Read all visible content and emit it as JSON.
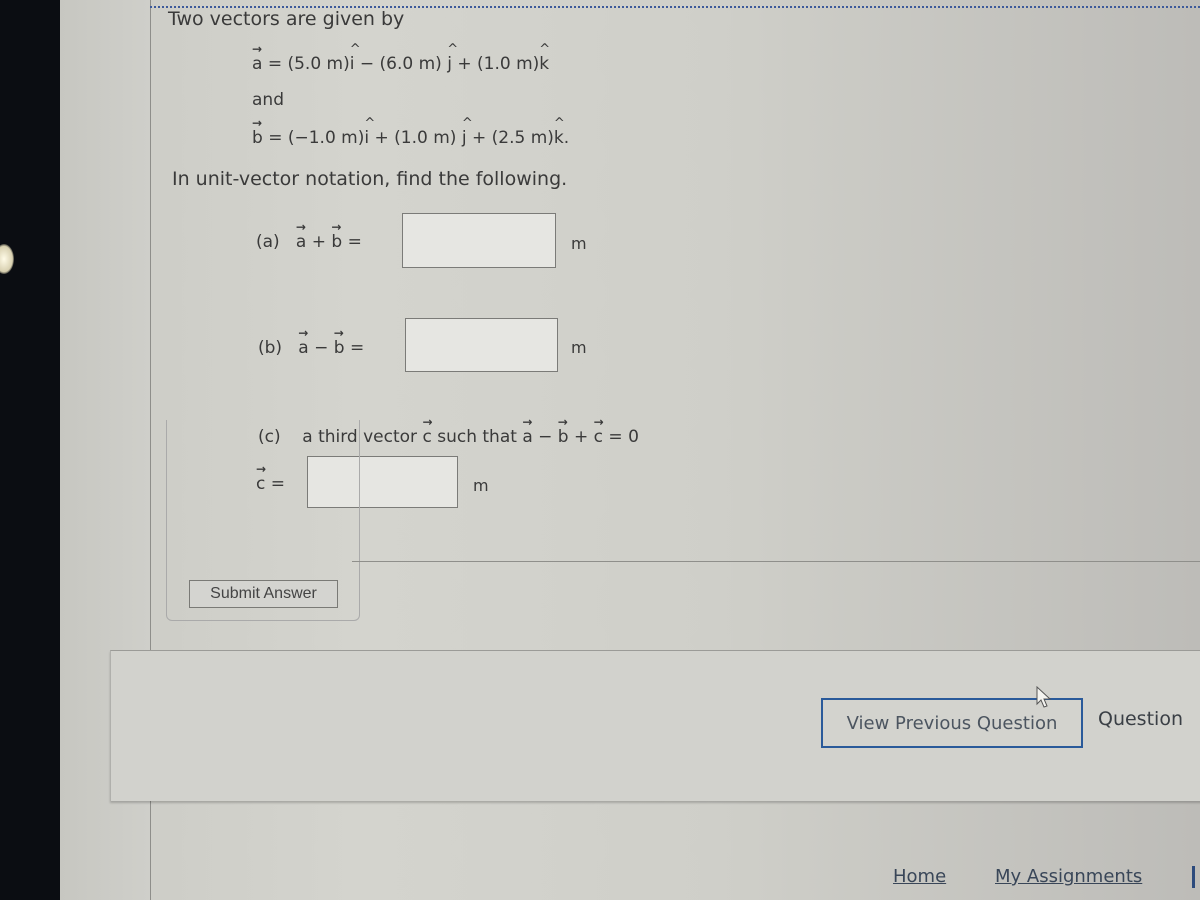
{
  "question": {
    "intro": "Two vectors are given by",
    "vector_a": {
      "symbol": "a",
      "terms": [
        "(5.0 m)",
        "i",
        " − (6.0 m) ",
        "j",
        " + (1.0 m)",
        "k"
      ],
      "equals": " = "
    },
    "connector": "and",
    "vector_b": {
      "symbol": "b",
      "terms": [
        "(−1.0 m)",
        "i",
        " + (1.0 m) ",
        "j",
        " + (2.5 m)",
        "k",
        "."
      ],
      "equals": " = "
    },
    "instruction": "In unit-vector notation, find the following."
  },
  "parts": [
    {
      "label": "(a)",
      "lhs_a": "a",
      "op": "+",
      "lhs_b": "b",
      "equals": "=",
      "value": "",
      "unit": "m"
    },
    {
      "label": "(b)",
      "lhs_a": "a",
      "op": "−",
      "lhs_b": "b",
      "equals": "=",
      "value": "",
      "unit": "m"
    },
    {
      "label": "(c)",
      "description_prefix": "a third vector ",
      "description_vec": "c",
      "description_mid": " such that ",
      "cond_a": "a",
      "cond_op1": " − ",
      "cond_b": "b",
      "cond_op2": " + ",
      "cond_c": "c",
      "cond_end": " = 0",
      "lhs": "c",
      "equals": " =",
      "value": "",
      "unit": "m"
    }
  ],
  "buttons": {
    "submit": "Submit Answer",
    "view_previous": "View Previous Question",
    "next_partial": "Question"
  },
  "footer": {
    "home": "Home",
    "my_assignments": "My Assignments"
  },
  "icons": {
    "cursor": "mouse-pointer-icon"
  },
  "colors": {
    "accent_border": "#2a5a9a",
    "link": "#394658"
  }
}
